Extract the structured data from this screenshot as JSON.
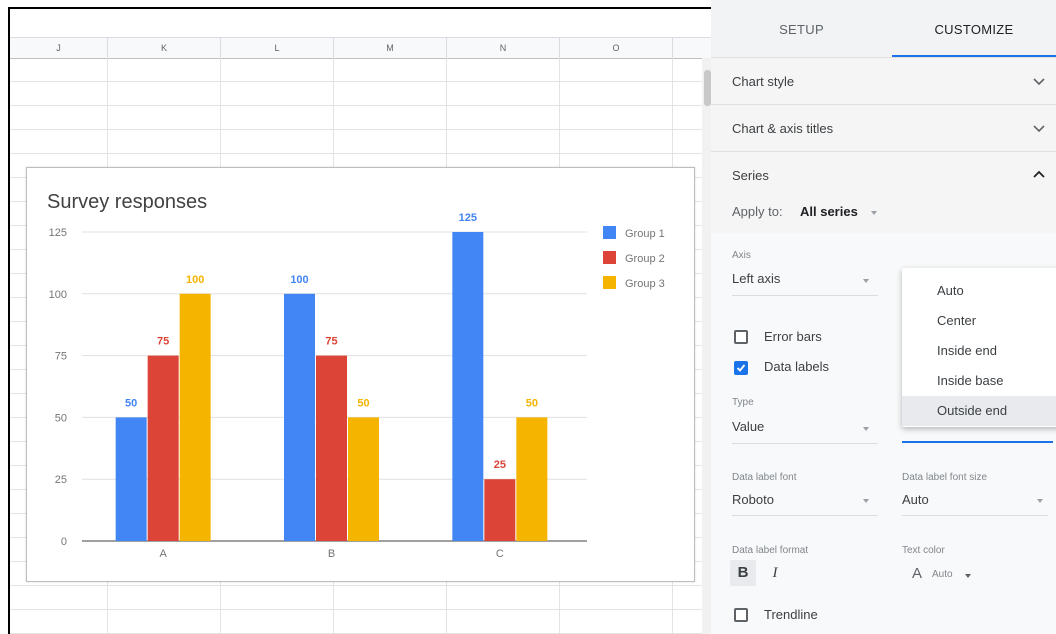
{
  "sheet": {
    "columns": [
      "J",
      "K",
      "L",
      "M",
      "N",
      "O"
    ]
  },
  "chart_data": {
    "type": "bar",
    "title": "Survey responses",
    "categories": [
      "A",
      "B",
      "C"
    ],
    "series": [
      {
        "name": "Group 1",
        "values": [
          50,
          100,
          125
        ],
        "color": "#4285f4"
      },
      {
        "name": "Group 2",
        "values": [
          75,
          75,
          25
        ],
        "color": "#db4437"
      },
      {
        "name": "Group 3",
        "values": [
          100,
          50,
          50
        ],
        "color": "#f4b400"
      }
    ],
    "yticks": [
      0,
      25,
      50,
      75,
      100,
      125
    ],
    "ylim": [
      0,
      125
    ],
    "data_labels": true,
    "data_label_position": "outside end",
    "legend": "right",
    "grid": true,
    "label_colors": [
      "#4285f4",
      "#db4437",
      "#f4b400"
    ]
  },
  "panel": {
    "tabs": [
      "SETUP",
      "CUSTOMIZE"
    ],
    "sections": {
      "chart_style": "Chart style",
      "titles": "Chart & axis titles",
      "series": "Series"
    },
    "apply_to_label": "Apply to:",
    "apply_to_value": "All series",
    "axis_label": "Axis",
    "axis_value": "Left axis",
    "error_bars_label": "Error bars",
    "data_labels_label": "Data labels",
    "type_label": "Type",
    "type_value": "Value",
    "font_label": "Data label font",
    "font_value": "Roboto",
    "font_size_label": "Data label font size",
    "font_size_value": "Auto",
    "format_label": "Data label format",
    "bold": "B",
    "italic": "I",
    "text_color_label": "Text color",
    "text_color_glyph": "A",
    "text_color_value": "Auto",
    "trendline_label": "Trendline",
    "position_options": [
      "Auto",
      "Center",
      "Inside end",
      "Inside base",
      "Outside end"
    ],
    "position_selected": "Outside end"
  },
  "colors": {
    "accent": "#1a73e8"
  }
}
